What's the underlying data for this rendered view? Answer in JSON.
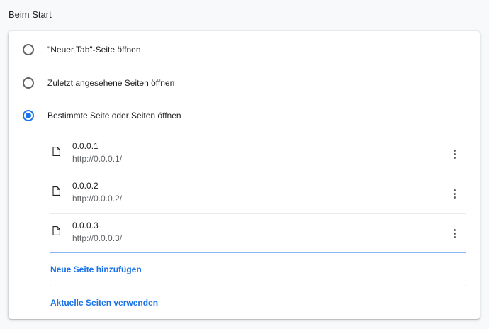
{
  "section": {
    "title": "Beim Start"
  },
  "options": [
    {
      "label": "\"Neuer Tab\"-Seite öffnen",
      "checked": false
    },
    {
      "label": "Zuletzt angesehene Seiten öffnen",
      "checked": false
    },
    {
      "label": "Bestimmte Seite oder Seiten öffnen",
      "checked": true
    }
  ],
  "pages": [
    {
      "title": "0.0.0.1",
      "url": "http://0.0.0.1/",
      "icon": "page-icon",
      "menu_icon": "more-vert-icon"
    },
    {
      "title": "0.0.0.2",
      "url": "http://0.0.0.2/",
      "icon": "page-icon",
      "menu_icon": "more-vert-icon"
    },
    {
      "title": "0.0.0.3",
      "url": "http://0.0.0.3/",
      "icon": "page-icon",
      "menu_icon": "more-vert-icon"
    }
  ],
  "actions": {
    "add_page": "Neue Seite hinzufügen",
    "use_current": "Aktuelle Seiten verwenden"
  },
  "colors": {
    "accent": "#1a73e8",
    "text": "#202124",
    "secondary": "#5f6368"
  }
}
